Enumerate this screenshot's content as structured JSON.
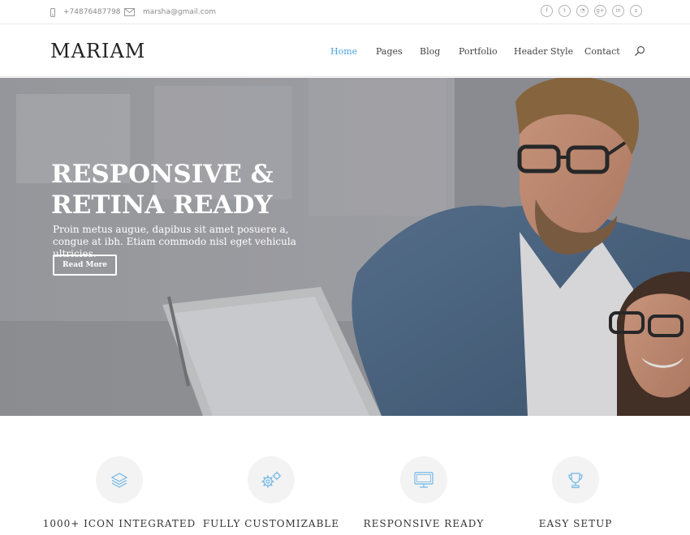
{
  "topbar": {
    "phone": "+74876487798",
    "email": "marsha@gmail.com",
    "socials": [
      {
        "icon": "facebook-icon",
        "glyph": "f"
      },
      {
        "icon": "twitter-icon",
        "glyph": "t"
      },
      {
        "icon": "rss-icon",
        "glyph": "◔"
      },
      {
        "icon": "google-plus-icon",
        "glyph": "g+"
      },
      {
        "icon": "linkedin-icon",
        "glyph": "in"
      },
      {
        "icon": "skype-icon",
        "glyph": "s"
      }
    ]
  },
  "header": {
    "logo": "MARIAM",
    "nav": [
      {
        "label": "Home",
        "active": true
      },
      {
        "label": "Pages",
        "active": false
      },
      {
        "label": "Blog",
        "active": false
      },
      {
        "label": "Portfolio",
        "active": false
      },
      {
        "label": "Header Style",
        "active": false
      },
      {
        "label": "Contact",
        "active": false
      }
    ]
  },
  "hero": {
    "title_line1": "RESPONSIVE &",
    "title_line2": "RETINA READY",
    "text": "Proin metus augue, dapibus sit amet posuere a, congue at ibh. Etiam commodo nisl eget vehicula ultricies.",
    "button": "Read More"
  },
  "features": [
    {
      "title": "1000+ ICON INTEGRATED",
      "icon": "layers-icon"
    },
    {
      "title": "FULLY CUSTOMIZABLE",
      "icon": "gears-icon"
    },
    {
      "title": "RESPONSIVE READY",
      "icon": "monitor-icon"
    },
    {
      "title": "EASY SETUP",
      "icon": "trophy-icon"
    }
  ],
  "colors": {
    "accent": "#4aa3df",
    "icon": "#6fb6e6",
    "text": "#333333"
  }
}
